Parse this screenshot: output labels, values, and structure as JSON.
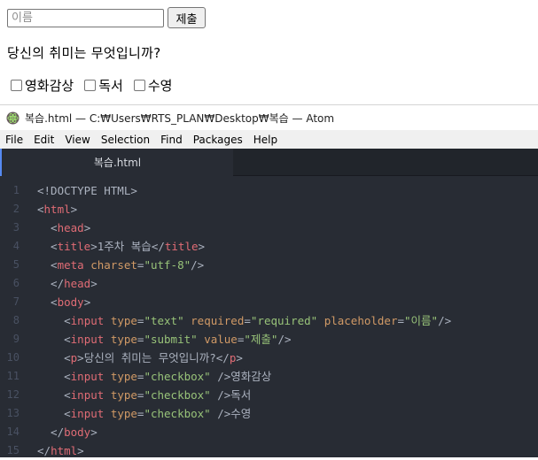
{
  "page": {
    "input_placeholder": "이름",
    "submit_label": "제출",
    "question": "당신의 취미는 무엇입니까?",
    "hobbies": [
      "영화감상",
      "독서",
      "수영"
    ]
  },
  "window": {
    "title": "복습.html — C:₩Users₩RTS_PLAN₩Desktop₩복습 — Atom",
    "icon": "atom-logo-icon"
  },
  "menu": [
    "File",
    "Edit",
    "View",
    "Selection",
    "Find",
    "Packages",
    "Help"
  ],
  "tab": {
    "label": "복습.html"
  },
  "editor": {
    "line_numbers": [
      "1",
      "2",
      "3",
      "4",
      "5",
      "6",
      "7",
      "8",
      "9",
      "10",
      "11",
      "12",
      "13",
      "14",
      "15"
    ],
    "lines": [
      [
        {
          "c": "d",
          "v": "<!DOCTYPE HTML>"
        }
      ],
      [
        {
          "c": "p",
          "v": "<"
        },
        {
          "c": "t",
          "v": "html"
        },
        {
          "c": "p",
          "v": ">"
        }
      ],
      [
        {
          "c": "p",
          "v": "  <"
        },
        {
          "c": "t",
          "v": "head"
        },
        {
          "c": "p",
          "v": ">"
        }
      ],
      [
        {
          "c": "p",
          "v": "  <"
        },
        {
          "c": "t",
          "v": "title"
        },
        {
          "c": "p",
          "v": ">"
        },
        {
          "c": "x",
          "v": "1주차 복습"
        },
        {
          "c": "p",
          "v": "</"
        },
        {
          "c": "t",
          "v": "title"
        },
        {
          "c": "p",
          "v": ">"
        }
      ],
      [
        {
          "c": "p",
          "v": "  <"
        },
        {
          "c": "t",
          "v": "meta"
        },
        {
          "c": "p",
          "v": " "
        },
        {
          "c": "a",
          "v": "charset"
        },
        {
          "c": "p",
          "v": "="
        },
        {
          "c": "s",
          "v": "\"utf-8\""
        },
        {
          "c": "p",
          "v": "/>"
        }
      ],
      [
        {
          "c": "p",
          "v": "  </"
        },
        {
          "c": "t",
          "v": "head"
        },
        {
          "c": "p",
          "v": ">"
        }
      ],
      [
        {
          "c": "p",
          "v": "  <"
        },
        {
          "c": "t",
          "v": "body"
        },
        {
          "c": "p",
          "v": ">"
        }
      ],
      [
        {
          "c": "p",
          "v": "    <"
        },
        {
          "c": "t",
          "v": "input"
        },
        {
          "c": "p",
          "v": " "
        },
        {
          "c": "a",
          "v": "type"
        },
        {
          "c": "p",
          "v": "="
        },
        {
          "c": "s",
          "v": "\"text\""
        },
        {
          "c": "p",
          "v": " "
        },
        {
          "c": "a",
          "v": "required"
        },
        {
          "c": "p",
          "v": "="
        },
        {
          "c": "s",
          "v": "\"required\""
        },
        {
          "c": "p",
          "v": " "
        },
        {
          "c": "a",
          "v": "placeholder"
        },
        {
          "c": "p",
          "v": "="
        },
        {
          "c": "s",
          "v": "\"이름\""
        },
        {
          "c": "p",
          "v": "/>"
        }
      ],
      [
        {
          "c": "p",
          "v": "    <"
        },
        {
          "c": "t",
          "v": "input"
        },
        {
          "c": "p",
          "v": " "
        },
        {
          "c": "a",
          "v": "type"
        },
        {
          "c": "p",
          "v": "="
        },
        {
          "c": "s",
          "v": "\"submit\""
        },
        {
          "c": "p",
          "v": " "
        },
        {
          "c": "a",
          "v": "value"
        },
        {
          "c": "p",
          "v": "="
        },
        {
          "c": "s",
          "v": "\"제출\""
        },
        {
          "c": "p",
          "v": "/>"
        }
      ],
      [
        {
          "c": "p",
          "v": "    <"
        },
        {
          "c": "t",
          "v": "p"
        },
        {
          "c": "p",
          "v": ">"
        },
        {
          "c": "x",
          "v": "당신의 취미는 무엇입니까?"
        },
        {
          "c": "p",
          "v": "</"
        },
        {
          "c": "t",
          "v": "p"
        },
        {
          "c": "p",
          "v": ">"
        }
      ],
      [
        {
          "c": "p",
          "v": "    <"
        },
        {
          "c": "t",
          "v": "input"
        },
        {
          "c": "p",
          "v": " "
        },
        {
          "c": "a",
          "v": "type"
        },
        {
          "c": "p",
          "v": "="
        },
        {
          "c": "s",
          "v": "\"checkbox\""
        },
        {
          "c": "p",
          "v": " />"
        },
        {
          "c": "x",
          "v": "영화감상"
        }
      ],
      [
        {
          "c": "p",
          "v": "    <"
        },
        {
          "c": "t",
          "v": "input"
        },
        {
          "c": "p",
          "v": " "
        },
        {
          "c": "a",
          "v": "type"
        },
        {
          "c": "p",
          "v": "="
        },
        {
          "c": "s",
          "v": "\"checkbox\""
        },
        {
          "c": "p",
          "v": " />"
        },
        {
          "c": "x",
          "v": "독서"
        }
      ],
      [
        {
          "c": "p",
          "v": "    <"
        },
        {
          "c": "t",
          "v": "input"
        },
        {
          "c": "p",
          "v": " "
        },
        {
          "c": "a",
          "v": "type"
        },
        {
          "c": "p",
          "v": "="
        },
        {
          "c": "s",
          "v": "\"checkbox\""
        },
        {
          "c": "p",
          "v": " />"
        },
        {
          "c": "x",
          "v": "수영"
        }
      ],
      [
        {
          "c": "p",
          "v": "  </"
        },
        {
          "c": "t",
          "v": "body"
        },
        {
          "c": "p",
          "v": ">"
        }
      ],
      [
        {
          "c": "p",
          "v": "</"
        },
        {
          "c": "t",
          "v": "html"
        },
        {
          "c": "p",
          "v": ">"
        }
      ]
    ]
  },
  "colors": {
    "editor_bg": "#282c34",
    "tag": "#e06c75",
    "attribute": "#d19a66",
    "string": "#98c379",
    "text": "#abb2bf",
    "line_number": "#495162",
    "tab_accent": "#568af2"
  }
}
